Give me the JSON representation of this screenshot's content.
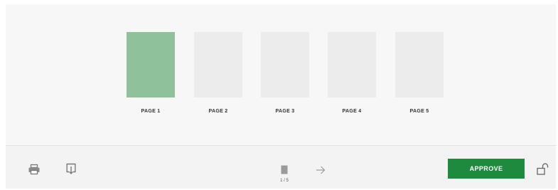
{
  "pages": [
    {
      "label": "PAGE 1",
      "selected": true
    },
    {
      "label": "PAGE 2",
      "selected": false
    },
    {
      "label": "PAGE 3",
      "selected": false
    },
    {
      "label": "PAGE 4",
      "selected": false
    },
    {
      "label": "PAGE 5",
      "selected": false
    }
  ],
  "toolbar": {
    "page_indicator": "1 / 5",
    "approve_label": "APPROVE",
    "icons": [
      "print-icon",
      "download-icon",
      "page-icon",
      "arrow-right-icon",
      "unlock-icon"
    ]
  },
  "colors": {
    "selected_page": "#8fc19a",
    "page": "#ececec",
    "approve_button": "#1e8a3e"
  }
}
